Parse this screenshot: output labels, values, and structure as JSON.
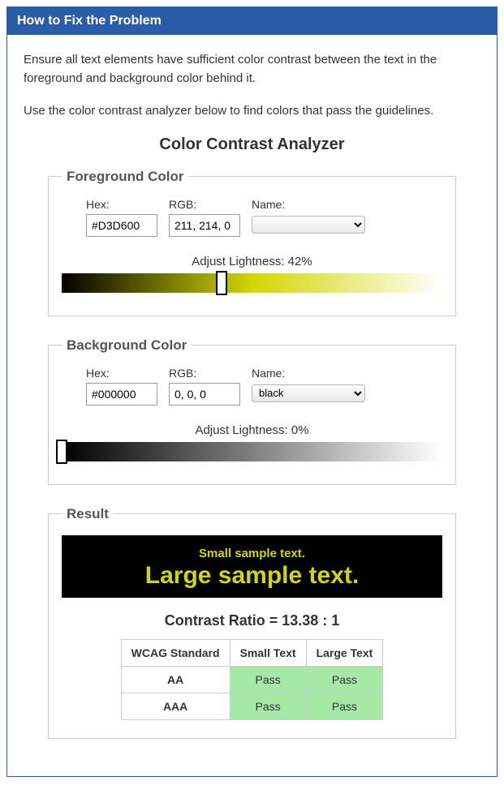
{
  "header": {
    "title": "How to Fix the Problem"
  },
  "intro": {
    "p1": "Ensure all text elements have sufficient color contrast between the text in the foreground and background color behind it.",
    "p2": "Use the color contrast analyzer below to find colors that pass the guidelines."
  },
  "analyzer": {
    "title": "Color Contrast Analyzer",
    "foreground": {
      "legend": "Foreground Color",
      "hex_label": "Hex:",
      "hex_value": "#D3D600",
      "rgb_label": "RGB:",
      "rgb_value": "211, 214, 0",
      "name_label": "Name:",
      "name_value": "",
      "lightness_label": "Adjust Lightness: 42%",
      "lightness_percent": 42,
      "gradient_mid": "#d3d600"
    },
    "background": {
      "legend": "Background Color",
      "hex_label": "Hex:",
      "hex_value": "#000000",
      "rgb_label": "RGB:",
      "rgb_value": "0, 0, 0",
      "name_label": "Name:",
      "name_value": "black",
      "lightness_label": "Adjust Lightness: 0%",
      "lightness_percent": 0,
      "gradient_mid": "#808080"
    },
    "result": {
      "legend": "Result",
      "sample_small": "Small sample text.",
      "sample_large": "Large sample text.",
      "ratio_label": "Contrast Ratio = 13.38 : 1",
      "table": {
        "headers": [
          "WCAG Standard",
          "Small Text",
          "Large Text"
        ],
        "rows": [
          {
            "standard": "AA",
            "small": "Pass",
            "large": "Pass"
          },
          {
            "standard": "AAA",
            "small": "Pass",
            "large": "Pass"
          }
        ]
      }
    }
  }
}
